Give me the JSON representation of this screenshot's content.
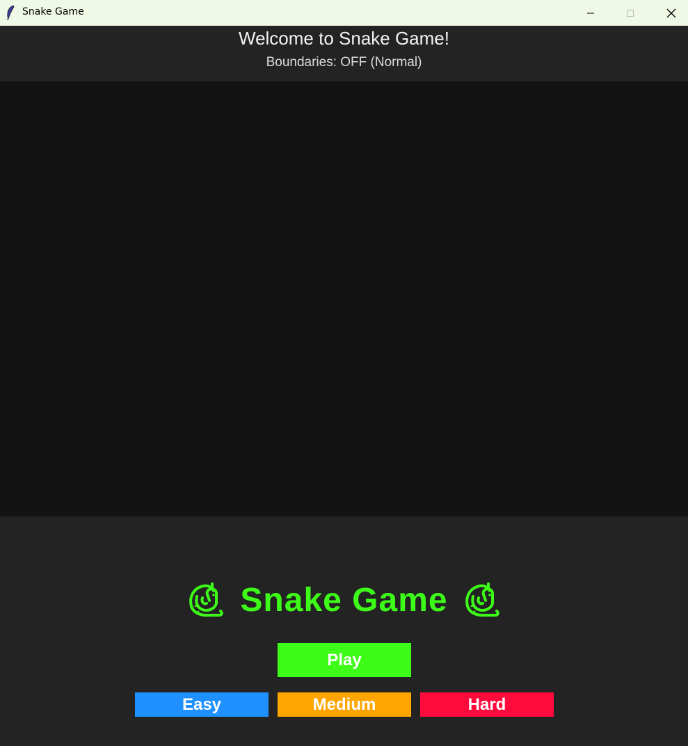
{
  "window": {
    "title": "Snake Game",
    "icon": "feather-icon"
  },
  "header": {
    "title": "Welcome to Snake Game!",
    "subtitle": "Boundaries: OFF (Normal)"
  },
  "menu": {
    "logo_text": "Snake Game",
    "logo_icon": "snake-icon",
    "play_label": "Play",
    "difficulties": [
      {
        "label": "Easy",
        "color": "#1e90ff"
      },
      {
        "label": "Medium",
        "color": "#ffa500"
      },
      {
        "label": "Hard",
        "color": "#ff0a3c"
      }
    ],
    "play_color": "#3dfc17",
    "accent_color": "#3dfc17"
  }
}
